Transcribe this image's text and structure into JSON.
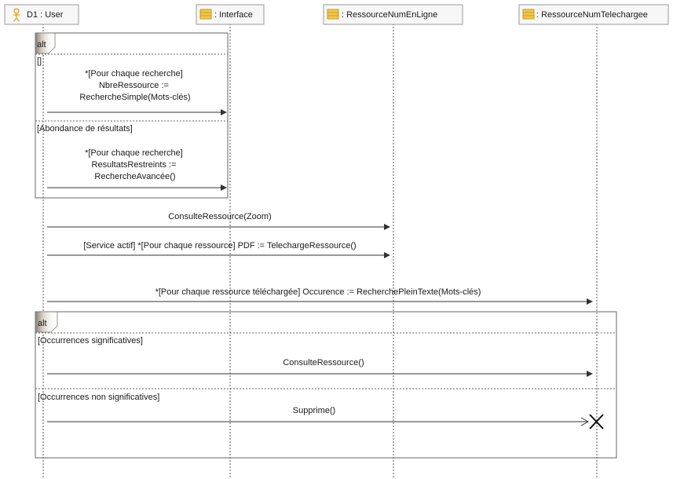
{
  "lifelines": [
    {
      "id": "user",
      "label": "D1 : User",
      "icon": "actor-icon"
    },
    {
      "id": "interface",
      "label": ": Interface",
      "icon": "class-icon"
    },
    {
      "id": "enligne",
      "label": ": RessourceNumEnLigne",
      "icon": "class-icon"
    },
    {
      "id": "telechargee",
      "label": ": RessourceNumTelechargee",
      "icon": "class-icon"
    }
  ],
  "fragments": [
    {
      "operator": "alt",
      "operands": [
        {
          "guard": "[]",
          "message": [
            "*[Pour chaque recherche]",
            "NbreRessource :=",
            "RechercheSimple(Mots-clés)"
          ]
        },
        {
          "guard": "[Abondance de résultats]",
          "message": [
            "*[Pour chaque recherche]",
            "ResultatsRestreints :=",
            "RechercheAvancée()"
          ]
        }
      ]
    },
    {
      "operator": "alt",
      "operands": [
        {
          "guard": "[Occurrences significatives]",
          "message": [
            "ConsulteRessource()"
          ]
        },
        {
          "guard": "[Occurrences non significatives]",
          "message": [
            "Supprime()"
          ]
        }
      ]
    }
  ],
  "messages": [
    {
      "label": "ConsulteRessource(Zoom)"
    },
    {
      "label": "[Service actif] *[Pour chaque ressource] PDF := TelechargeRessource()"
    },
    {
      "label": "*[Pour chaque ressource téléchargée] Occurence := RecherchePleinTexte(Mots-clés)"
    }
  ],
  "colors": {
    "lifeline_header_bg": "#f7f7f7",
    "class_icon": "#f2c94c",
    "actor_icon": "#e8a838",
    "fragment_tab": "#c9c2b8",
    "line": "#333333"
  }
}
